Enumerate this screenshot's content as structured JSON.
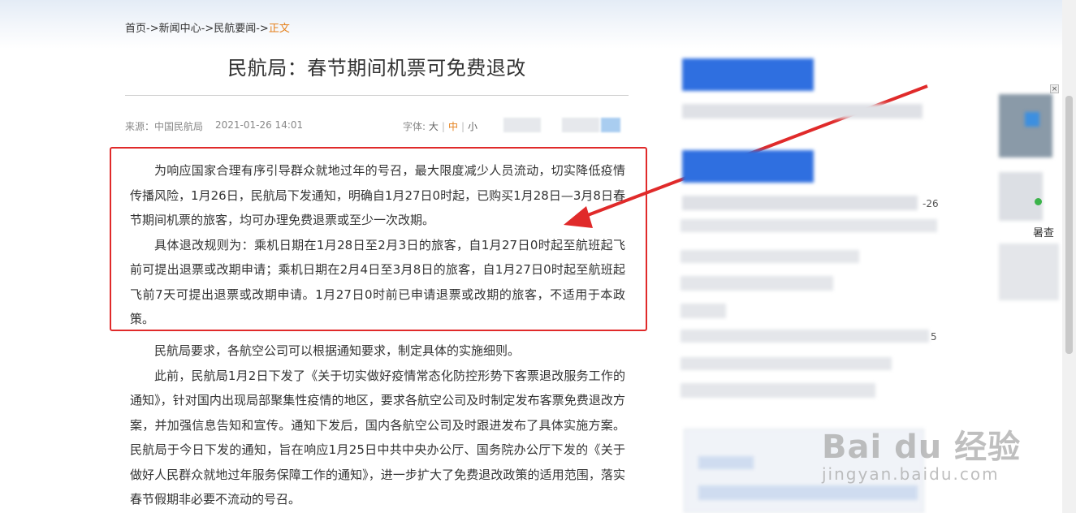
{
  "breadcrumb": {
    "home": "首页",
    "news_center": "新闻中心",
    "caac_news": "民航要闻",
    "current": "正文",
    "separator": "->"
  },
  "article": {
    "title": "民航局：春节期间机票可免费退改",
    "source": "来源：中国民航局",
    "date": "2021-01-26 14:01",
    "font_label": "字体:",
    "font_sizes": [
      "大",
      "中",
      "小"
    ],
    "active_font_size": "中",
    "paragraphs": [
      "为响应国家合理有序引导群众就地过年的号召，最大限度减少人员流动，切实降低疫情传播风险，1月26日，民航局下发通知，明确自1月27日0时起，已购买1月28日—3月8日春节期间机票的旅客，均可办理免费退票或至少一次改期。",
      "具体退改规则为：乘机日期在1月28日至2月3日的旅客，自1月27日0时起至航班起飞前可提出退票或改期申请；乘机日期在2月4日至3月8日的旅客，自1月27日0时起至航班起飞前7天可提出退票或改期申请。1月27日0时前已申请退票或改期的旅客，不适用于本政策。",
      "民航局要求，各航空公司可以根据通知要求，制定具体的实施细则。",
      "此前，民航局1月2日下发了《关于切实做好疫情常态化防控形势下客票退改服务工作的通知》，针对国内出现局部聚集性疫情的地区，要求各航空公司及时制定发布客票免费退改方案，并加强信息告知和宣传。通知下发后，国内各航空公司及时跟进发布了具体实施方案。民航局于今日下发的通知，旨在响应1月25日中共中央办公厅、国务院办公厅下发的《关于做好人民群众就地过年服务保障工作的通知》，进一步扩大了免费退改政策的适用范围，落实春节假期非必要不流动的号召。"
    ]
  },
  "sidebar": {
    "partial_date": "-26",
    "partial_digit": "5",
    "ad_partial_text": "暑查",
    "ad_close": "×"
  },
  "watermark": {
    "main": "Bai du 经验",
    "sub": "jingyan.baidu.com"
  },
  "colors": {
    "accent": "#e5801b",
    "highlight_border": "#e02a2a",
    "arrow": "#e02a2a",
    "sidebar_blue": "#2f6fe0"
  }
}
